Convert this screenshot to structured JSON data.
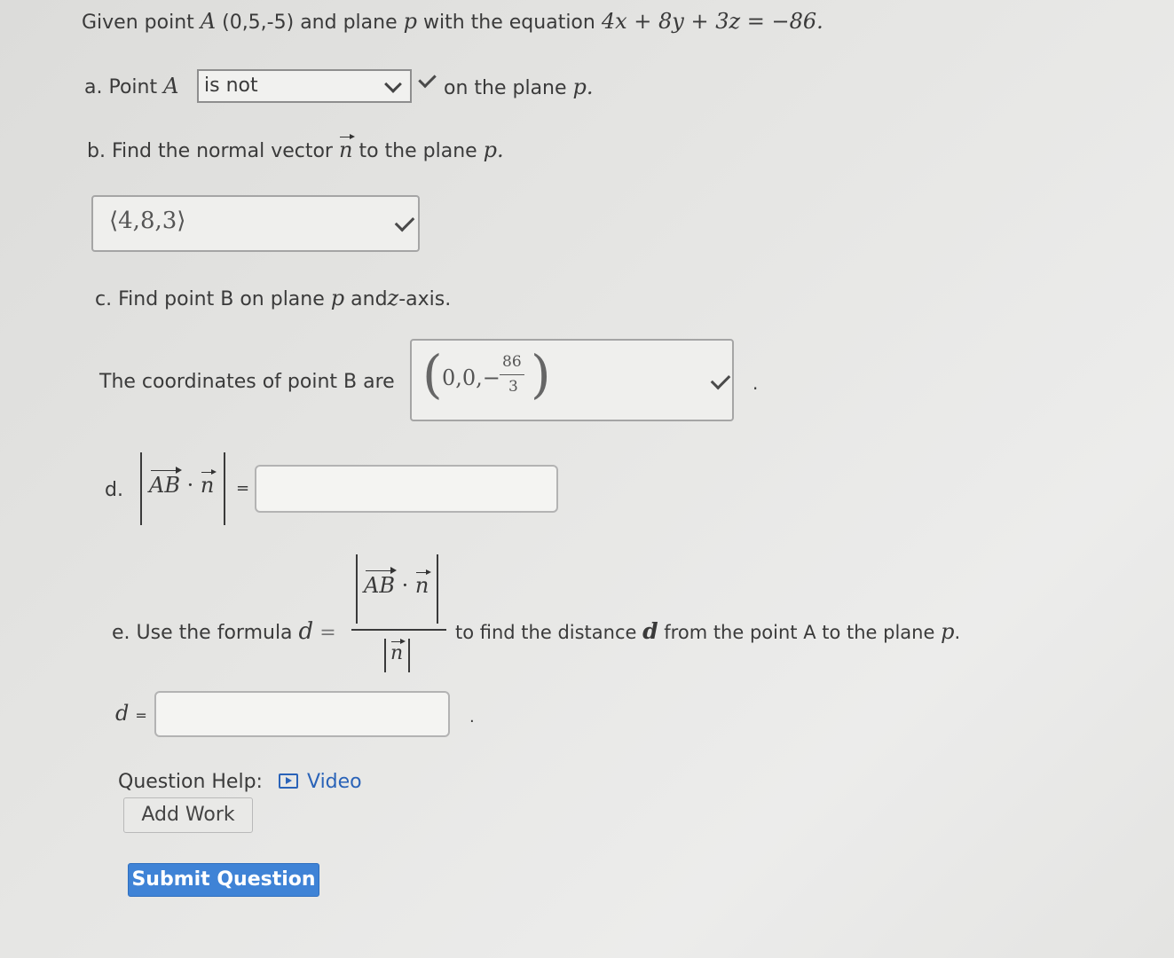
{
  "header": {
    "lead": "Given point",
    "point_name": "A",
    "point_coords": "(0,5,-5)",
    "mid": "and plane",
    "plane_name": "p",
    "eq_intro": "with the equation",
    "equation": "4x + 8y + 3z = −86."
  },
  "part_a": {
    "prefix": "a. Point",
    "point_name": "A",
    "select_value": "is not",
    "suffix": "on the plane",
    "plane_name": "p."
  },
  "part_b": {
    "prompt_pre": "b. Find the normal vector",
    "vec_name": "n",
    "prompt_post": "to the plane",
    "plane_name": "p.",
    "answer": "⟨4,8,3⟩"
  },
  "part_c": {
    "prompt_pre": "c. Find point B on plane",
    "plane_name": "p",
    "prompt_mid": "and",
    "axis_name": "z",
    "prompt_post": "-axis.",
    "coords_label": "The coordinates of point B are",
    "answer_prefix": "0,0,−",
    "answer_num": "86",
    "answer_den": "3",
    "period": "."
  },
  "part_d": {
    "label": "d.",
    "vec_ab": "AB",
    "dot": "·",
    "vec_n": "n",
    "equals": "=",
    "answer": ""
  },
  "part_e": {
    "prefix": "e. Use the formula",
    "var": "d",
    "equals": "=",
    "frac_num_ab": "AB",
    "frac_num_dot": "·",
    "frac_num_n": "n",
    "frac_den_n": "n",
    "suffix_pre": "to find the distance",
    "suffix_var": "d",
    "suffix_post": "from the point A to the plane",
    "plane_name": "p",
    "period": "."
  },
  "answer_d": {
    "var": "d",
    "equals": "=",
    "value": "",
    "period": "."
  },
  "help": {
    "label": "Question Help:",
    "video_label": "Video",
    "add_work": "Add Work",
    "submit": "Submit Question"
  },
  "colors": {
    "submit_bg": "#3f83d6",
    "link": "#2a63b8"
  }
}
